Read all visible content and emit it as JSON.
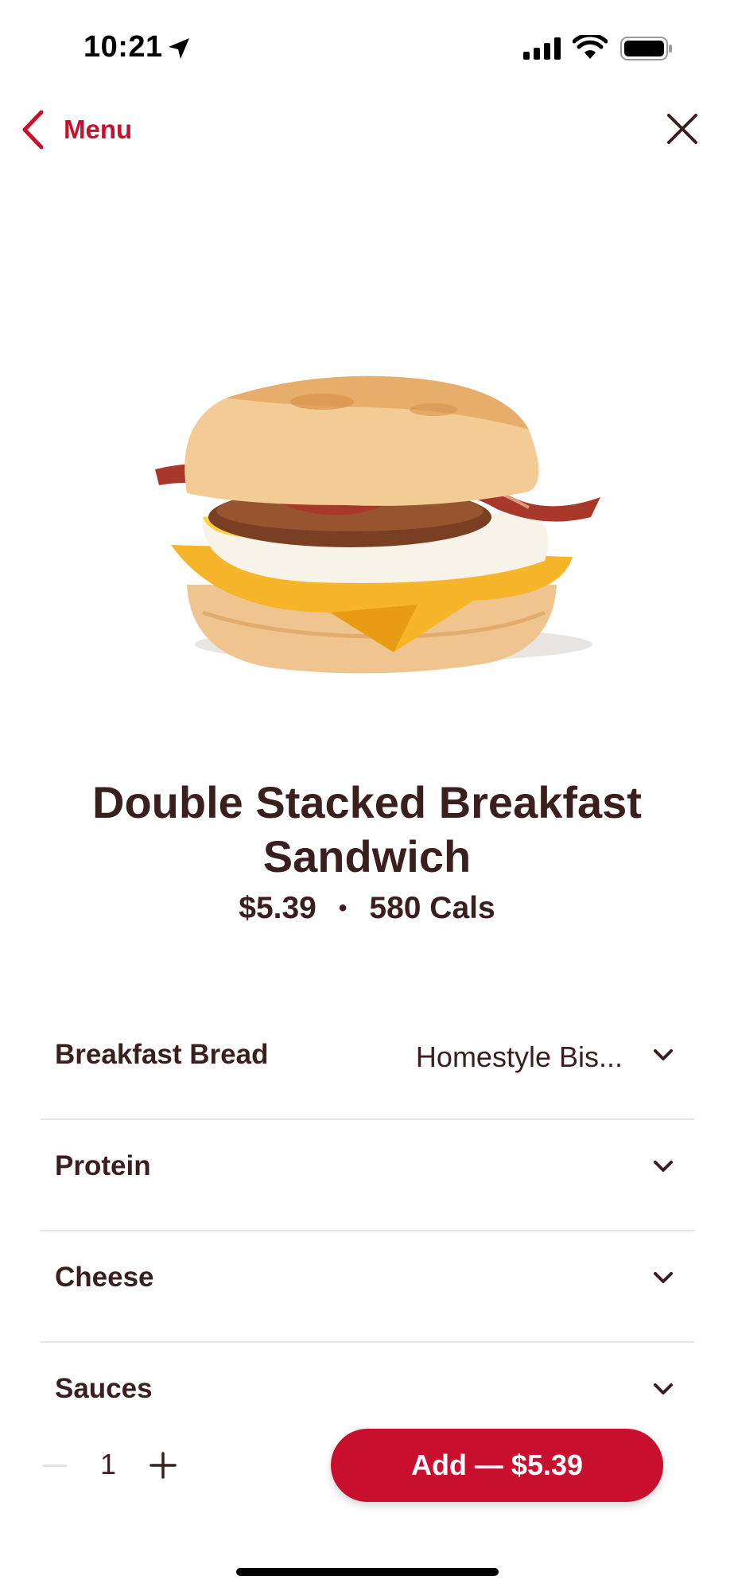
{
  "status_bar": {
    "time": "10:21",
    "icons": [
      "location-arrow-icon",
      "cellular-signal-icon",
      "wifi-icon",
      "battery-icon"
    ]
  },
  "header": {
    "back_label": "Menu",
    "back_icon": "chevron-left-icon",
    "close_icon": "close-icon"
  },
  "product": {
    "image": "breakfast-sandwich-image",
    "name": "Double Stacked Breakfast Sandwich",
    "price": "$5.39",
    "separator": "•",
    "calories": "580 Cals"
  },
  "options": [
    {
      "label": "Breakfast Bread",
      "value": "Homestyle Bis..."
    },
    {
      "label": "Protein",
      "value": ""
    },
    {
      "label": "Cheese",
      "value": ""
    },
    {
      "label": "Sauces",
      "value": ""
    }
  ],
  "quantity": {
    "value": "1",
    "minus_icon": "minus-icon",
    "plus_icon": "plus-icon"
  },
  "add_button": {
    "label": "Add — $5.39"
  },
  "colors": {
    "accent": "#c8102e",
    "text": "#3b1f1f",
    "divider": "#e6e4e4"
  }
}
